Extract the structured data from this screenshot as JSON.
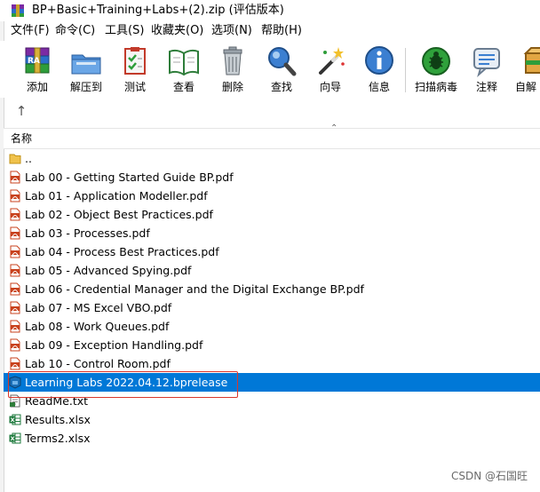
{
  "window": {
    "title": "BP+Basic+Training+Labs+(2).zip (评估版本)"
  },
  "menu": [
    {
      "label": "文件(F)",
      "name": "menu-file"
    },
    {
      "label": "命令(C)",
      "name": "menu-commands"
    },
    {
      "label": "工具(S)",
      "name": "menu-tools"
    },
    {
      "label": "收藏夹(O)",
      "name": "menu-favorites"
    },
    {
      "label": "选项(N)",
      "name": "menu-options"
    },
    {
      "label": "帮助(H)",
      "name": "menu-help"
    }
  ],
  "toolbar": [
    {
      "label": "添加",
      "icon": "add-archive-icon"
    },
    {
      "label": "解压到",
      "icon": "extract-to-icon"
    },
    {
      "label": "测试",
      "icon": "test-icon"
    },
    {
      "label": "查看",
      "icon": "view-icon"
    },
    {
      "label": "删除",
      "icon": "delete-icon"
    },
    {
      "label": "查找",
      "icon": "find-icon"
    },
    {
      "label": "向导",
      "icon": "wizard-icon"
    },
    {
      "label": "信息",
      "icon": "info-icon"
    },
    {
      "label": "扫描病毒",
      "icon": "virus-scan-icon"
    },
    {
      "label": "注释",
      "icon": "comment-icon"
    },
    {
      "label": "自解",
      "icon": "sfx-icon"
    }
  ],
  "nav": {
    "up_glyph": "↑"
  },
  "list": {
    "header": "名称",
    "files": [
      {
        "name": "..",
        "type": "folder"
      },
      {
        "name": "Lab 00 - Getting Started Guide BP.pdf",
        "type": "pdf"
      },
      {
        "name": "Lab 01 - Application Modeller.pdf",
        "type": "pdf"
      },
      {
        "name": "Lab 02 - Object Best Practices.pdf",
        "type": "pdf"
      },
      {
        "name": "Lab 03 - Processes.pdf",
        "type": "pdf"
      },
      {
        "name": "Lab 04 - Process Best Practices.pdf",
        "type": "pdf"
      },
      {
        "name": "Lab 05 - Advanced Spying.pdf",
        "type": "pdf"
      },
      {
        "name": "Lab 06 - Credential Manager and the Digital Exchange BP.pdf",
        "type": "pdf"
      },
      {
        "name": "Lab 07 - MS Excel VBO.pdf",
        "type": "pdf"
      },
      {
        "name": "Lab 08 - Work Queues.pdf",
        "type": "pdf"
      },
      {
        "name": "Lab 09 - Exception Handling.pdf",
        "type": "pdf"
      },
      {
        "name": "Lab 10 - Control Room.pdf",
        "type": "pdf"
      },
      {
        "name": "Learning Labs 2022.04.12.bprelease",
        "type": "bprelease",
        "selected": true
      },
      {
        "name": "ReadMe.txt",
        "type": "txt"
      },
      {
        "name": "Results.xlsx",
        "type": "xlsx"
      },
      {
        "name": "Terms2.xlsx",
        "type": "xlsx"
      }
    ]
  },
  "watermark": "CSDN @石国旺",
  "colors": {
    "selection": "#0078d7",
    "highlight_box": "#d9362b",
    "pdf": "#c8411c",
    "excel": "#1d7a3c",
    "folder": "#f0c24b"
  }
}
